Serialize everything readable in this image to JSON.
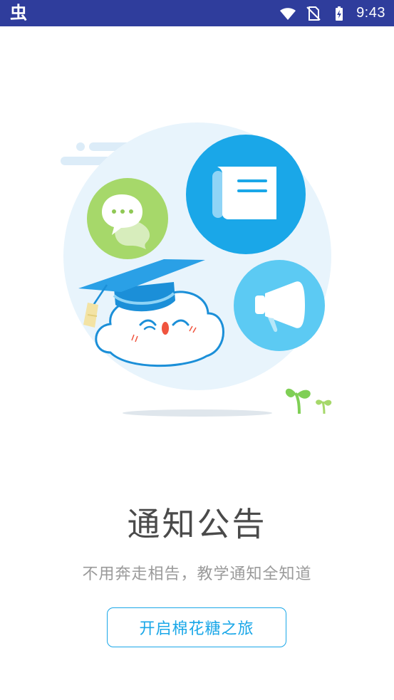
{
  "status_bar": {
    "app_glyph": "虫",
    "time": "9:43",
    "icons": [
      "wifi-icon",
      "no-sim-icon",
      "battery-charging-icon"
    ]
  },
  "illustration": {
    "icons": [
      "chat-bubbles-icon",
      "document-icon",
      "megaphone-icon",
      "graduation-cloud-mascot",
      "sprout-icon"
    ],
    "colors": {
      "background_circle": "#e8f4fc",
      "chat_green": "#a6d86a",
      "document_blue": "#1aa7e8",
      "megaphone_blue": "#5ccaf3",
      "cap_blue": "#1b8fd8"
    }
  },
  "content": {
    "title": "通知公告",
    "subtitle": "不用奔走相告，教学通知全知道",
    "button_label": "开启棉花糖之旅"
  },
  "colors": {
    "status_bar": "#2f3d9c",
    "accent": "#1aa7e8",
    "title_text": "#4a4a4a",
    "subtitle_text": "#9a9a9a"
  }
}
